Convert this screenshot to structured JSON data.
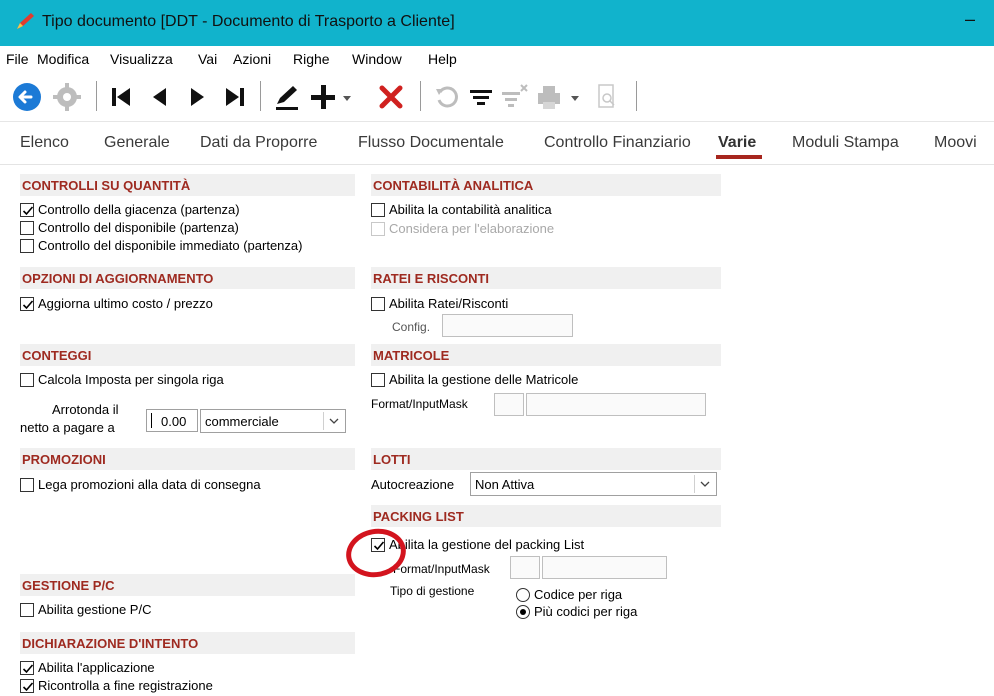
{
  "window": {
    "title": "Tipo documento [DDT - Documento di Trasporto a Cliente]",
    "minimize_glyph": "–",
    "app_icon": "pencil-icon",
    "accent_color": "#11b3cc"
  },
  "menu": [
    "File",
    "Modifica",
    "Visualizza",
    "Vai",
    "Azioni",
    "Righe",
    "Window",
    "Help"
  ],
  "toolbar": {
    "icons": [
      "back-icon",
      "gear-icon",
      "first-record-icon",
      "previous-record-icon",
      "next-record-icon",
      "last-record-icon",
      "edit-icon",
      "add-icon",
      "delete-icon",
      "refresh-icon",
      "filter-icon",
      "clear-filter-icon",
      "print-icon",
      "preview-icon"
    ]
  },
  "tabs": [
    "Elenco",
    "Generale",
    "Dati da Proporre",
    "Flusso Documentale",
    "Controllo Finanziario",
    "Varie",
    "Moduli Stampa",
    "Moovi"
  ],
  "active_tab": "Varie",
  "left": {
    "controlli": {
      "title": "CONTROLLI SU QUANTITÀ",
      "items": [
        {
          "label": "Controllo della giacenza (partenza)",
          "checked": true
        },
        {
          "label": "Controllo del disponibile (partenza)",
          "checked": false
        },
        {
          "label": "Controllo del disponibile immediato (partenza)",
          "checked": false
        }
      ]
    },
    "aggiornamento": {
      "title": "OPZIONI DI AGGIORNAMENTO",
      "items": [
        {
          "label": "Aggiorna ultimo costo / prezzo",
          "checked": true
        }
      ]
    },
    "conteggi": {
      "title": "CONTEGGI",
      "items": [
        {
          "label": "Calcola Imposta per singola riga",
          "checked": false
        }
      ],
      "round_label_1": "Arrotonda il",
      "round_label_2": "netto a pagare a",
      "round_value": "0.00",
      "round_mode": "commerciale"
    },
    "promozioni": {
      "title": "PROMOZIONI",
      "items": [
        {
          "label": "Lega promozioni alla data di consegna",
          "checked": false
        }
      ]
    },
    "gestione_pc": {
      "title": "GESTIONE P/C",
      "items": [
        {
          "label": "Abilita gestione P/C",
          "checked": false
        }
      ]
    },
    "dichiarazione": {
      "title": "DICHIARAZIONE D'INTENTO",
      "items": [
        {
          "label": "Abilita l'applicazione",
          "checked": true
        },
        {
          "label": "Ricontrolla a fine registrazione",
          "checked": true
        }
      ]
    }
  },
  "right": {
    "analitica": {
      "title": "CONTABILITÀ ANALITICA",
      "items": [
        {
          "label": "Abilita la contabilità analitica",
          "checked": false,
          "disabled": false
        },
        {
          "label": "Considera per l'elaborazione",
          "checked": false,
          "disabled": true
        }
      ]
    },
    "ratei": {
      "title": "RATEI E RISCONTI",
      "items": [
        {
          "label": "Abilita Ratei/Risconti",
          "checked": false
        }
      ],
      "config_label": "Config."
    },
    "matricole": {
      "title": "MATRICOLE",
      "items": [
        {
          "label": "Abilita la gestione delle Matricole",
          "checked": false
        }
      ],
      "mask_label": "Format/InputMask"
    },
    "lotti": {
      "title": "LOTTI",
      "auto_label": "Autocreazione",
      "auto_value": "Non Attiva"
    },
    "packing": {
      "title": "PACKING LIST",
      "items": [
        {
          "label": "Abilita la gestione del packing List",
          "checked": true
        }
      ],
      "mask_label": "Format/InputMask",
      "tipo_label": "Tipo di gestione",
      "radios": [
        {
          "label": "Codice per riga",
          "selected": false
        },
        {
          "label": "Più codici per riga",
          "selected": true
        }
      ]
    }
  },
  "annotation_color": "#d3141e"
}
